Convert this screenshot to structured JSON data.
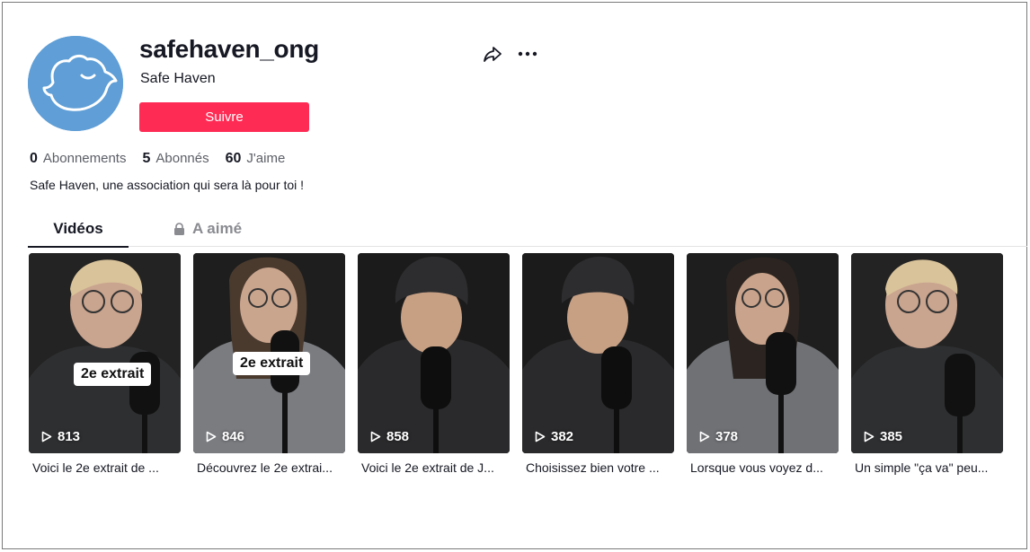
{
  "profile": {
    "username": "safehaven_ong",
    "nickname": "Safe Haven",
    "follow_label": "Suivre",
    "bio": "Safe Haven, une association qui sera là pour toi !",
    "avatar_color": "#5f9ed6"
  },
  "stats": {
    "following_count": "0",
    "following_label": "Abonnements",
    "followers_count": "5",
    "followers_label": "Abonnés",
    "likes_count": "60",
    "likes_label": "J'aime"
  },
  "tabs": {
    "videos": "Vidéos",
    "liked": "A aimé"
  },
  "videos": [
    {
      "views": "813",
      "caption": "Voici le 2e extrait de ...",
      "overlay": "2e extrait"
    },
    {
      "views": "846",
      "caption": "Découvrez le 2e extrai...",
      "overlay": "2e extrait"
    },
    {
      "views": "858",
      "caption": "Voici le 2e extrait de J..."
    },
    {
      "views": "382",
      "caption": "Choisissez bien votre ..."
    },
    {
      "views": "378",
      "caption": "Lorsque vous voyez d..."
    },
    {
      "views": "385",
      "caption": "Un simple \"ça va\" peu..."
    }
  ],
  "colors": {
    "accent": "#fe2c55",
    "text": "#161823",
    "muted": "#5c5f67"
  },
  "icons": [
    "share-icon",
    "more-icon",
    "lock-icon",
    "play-icon",
    "bird-logo-icon"
  ]
}
